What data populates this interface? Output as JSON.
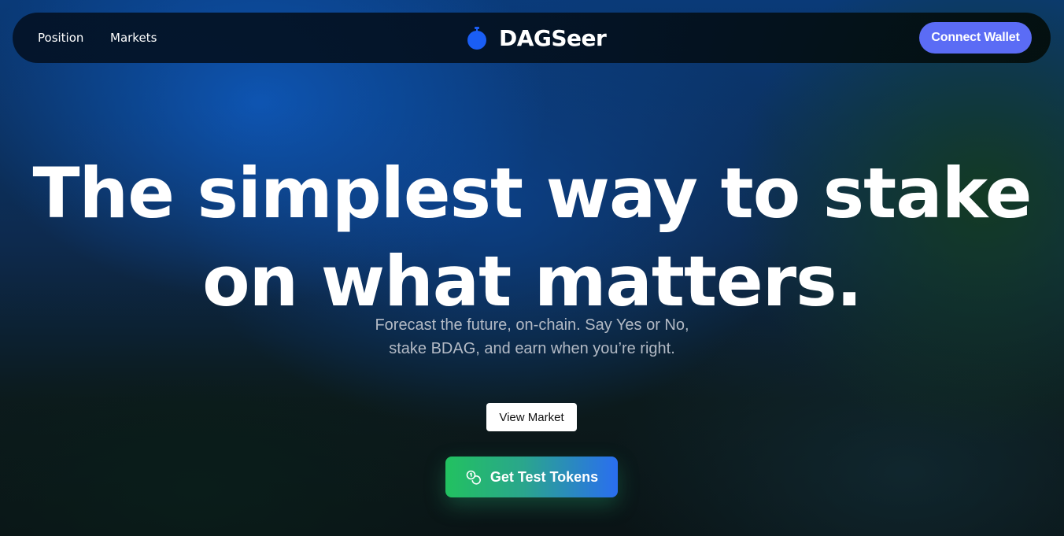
{
  "nav": {
    "links": [
      {
        "label": "Position"
      },
      {
        "label": "Markets"
      }
    ],
    "brand_name": "DAGSeer",
    "connect_label": "Connect Wallet"
  },
  "hero": {
    "headline_lines": [
      "The simplest way to stake",
      "on what matters."
    ],
    "subtitle_lines": [
      "Forecast the future, on-chain. Say Yes or No,",
      "stake BDAG, and earn when you’re right."
    ],
    "view_market_label": "View Market",
    "tokens_label": "Get Test Tokens"
  },
  "icons": {
    "brand": "stopwatch-icon",
    "tokens": "coins-icon"
  },
  "colors": {
    "accent": "#5b6cf5",
    "brand_blue": "#1a5ef5",
    "tokens_gradient_start": "#22c160",
    "tokens_gradient_end": "#2a6ef0"
  }
}
